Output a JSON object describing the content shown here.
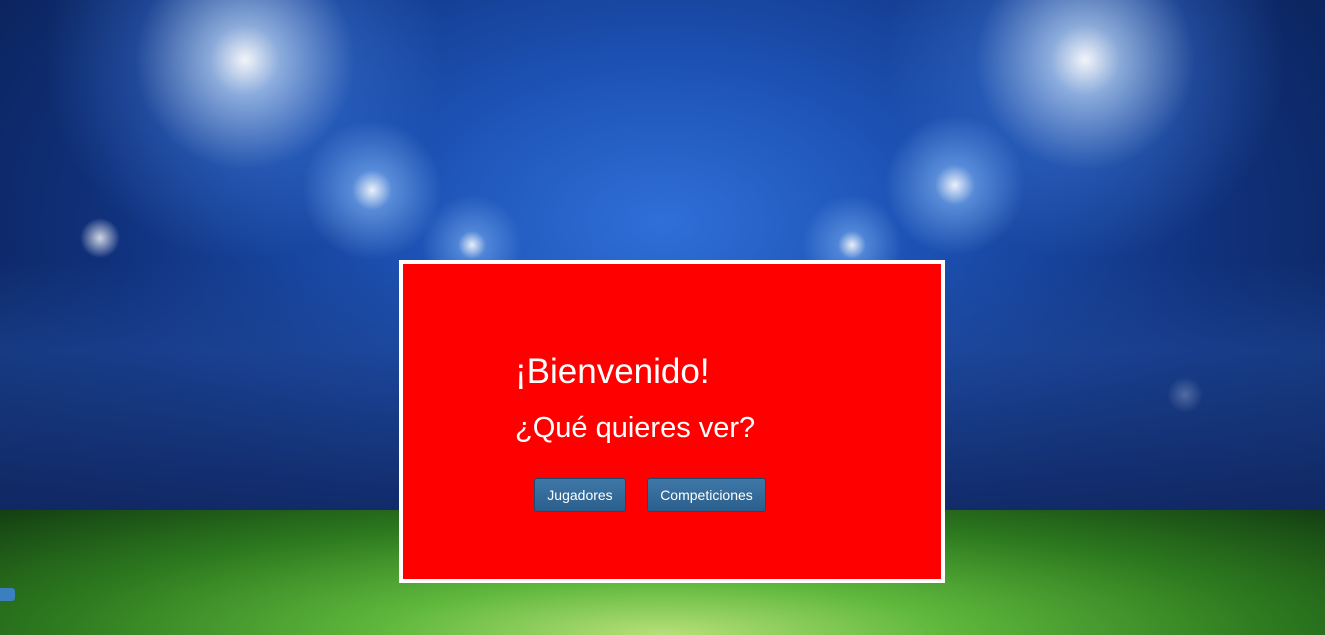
{
  "welcome": {
    "title": "¡Bienvenido!",
    "subtitle": "¿Qué quieres ver?"
  },
  "buttons": {
    "players_label": "Jugadores",
    "competitions_label": "Competiciones"
  },
  "colors": {
    "card_background": "#ff0000",
    "card_border": "#ffffff",
    "button_background": "#2f6a9a",
    "text": "#ffffff"
  },
  "background": {
    "scene": "stadium-floodlights-image"
  }
}
